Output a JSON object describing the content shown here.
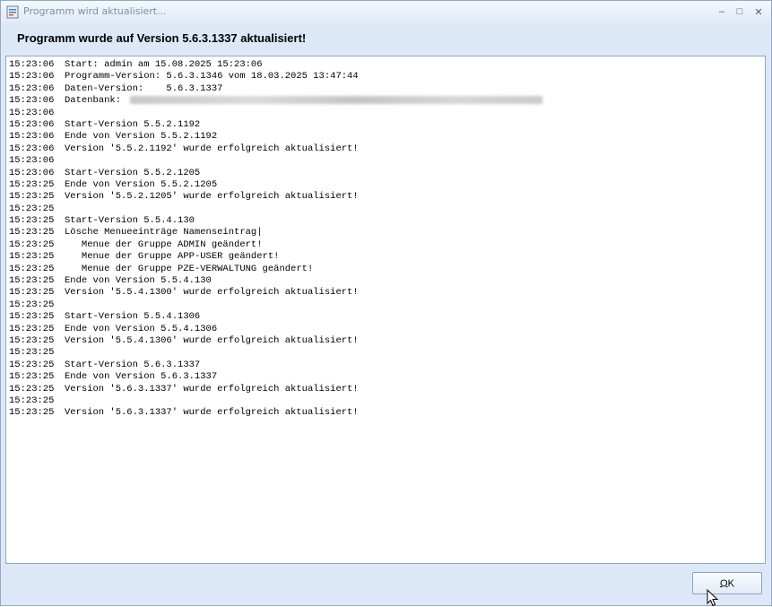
{
  "window": {
    "title": "Programm wird aktualisiert...",
    "minimize_glyph": "–",
    "maximize_glyph": "□",
    "close_glyph": "✕"
  },
  "header": {
    "text": "Programm wurde auf Version 5.6.3.1337 aktualisiert!"
  },
  "log": [
    {
      "time": "15:23:06",
      "msg": "Start: admin am 15.08.2025 15:23:06"
    },
    {
      "time": "15:23:06",
      "msg": "Programm-Version: 5.6.3.1346 vom 18.03.2025 13:47:44"
    },
    {
      "time": "15:23:06",
      "msg": "Daten-Version:    5.6.3.1337"
    },
    {
      "time": "15:23:06",
      "msg": "Datenbank:",
      "redacted": true
    },
    {
      "time": "15:23:06",
      "msg": ""
    },
    {
      "time": "15:23:06",
      "msg": "Start-Version 5.5.2.1192"
    },
    {
      "time": "15:23:06",
      "msg": "Ende von Version 5.5.2.1192"
    },
    {
      "time": "15:23:06",
      "msg": "Version '5.5.2.1192' wurde erfolgreich aktualisiert!"
    },
    {
      "time": "15:23:06",
      "msg": ""
    },
    {
      "time": "15:23:06",
      "msg": "Start-Version 5.5.2.1205"
    },
    {
      "time": "15:23:25",
      "msg": "Ende von Version 5.5.2.1205"
    },
    {
      "time": "15:23:25",
      "msg": "Version '5.5.2.1205' wurde erfolgreich aktualisiert!"
    },
    {
      "time": "15:23:25",
      "msg": ""
    },
    {
      "time": "15:23:25",
      "msg": "Start-Version 5.5.4.130"
    },
    {
      "time": "15:23:25",
      "msg": "Lösche Menueeinträge Namenseintrag|"
    },
    {
      "time": "15:23:25",
      "msg": "   Menue der Gruppe ADMIN geändert!"
    },
    {
      "time": "15:23:25",
      "msg": "   Menue der Gruppe APP-USER geändert!"
    },
    {
      "time": "15:23:25",
      "msg": "   Menue der Gruppe PZE-VERWALTUNG geändert!"
    },
    {
      "time": "15:23:25",
      "msg": "Ende von Version 5.5.4.130"
    },
    {
      "time": "15:23:25",
      "msg": "Version '5.5.4.1300' wurde erfolgreich aktualisiert!"
    },
    {
      "time": "15:23:25",
      "msg": ""
    },
    {
      "time": "15:23:25",
      "msg": "Start-Version 5.5.4.1306"
    },
    {
      "time": "15:23:25",
      "msg": "Ende von Version 5.5.4.1306"
    },
    {
      "time": "15:23:25",
      "msg": "Version '5.5.4.1306' wurde erfolgreich aktualisiert!"
    },
    {
      "time": "15:23:25",
      "msg": ""
    },
    {
      "time": "15:23:25",
      "msg": "Start-Version 5.6.3.1337"
    },
    {
      "time": "15:23:25",
      "msg": "Ende von Version 5.6.3.1337"
    },
    {
      "time": "15:23:25",
      "msg": "Version '5.6.3.1337' wurde erfolgreich aktualisiert!"
    },
    {
      "time": "15:23:25",
      "msg": ""
    },
    {
      "time": "15:23:25",
      "msg": "Version '5.6.3.1337' wurde erfolgreich aktualisiert!"
    }
  ],
  "buttons": {
    "ok_label": "OK"
  },
  "colors": {
    "window_bg": "#dde8f7",
    "border": "#8fa9cc"
  }
}
